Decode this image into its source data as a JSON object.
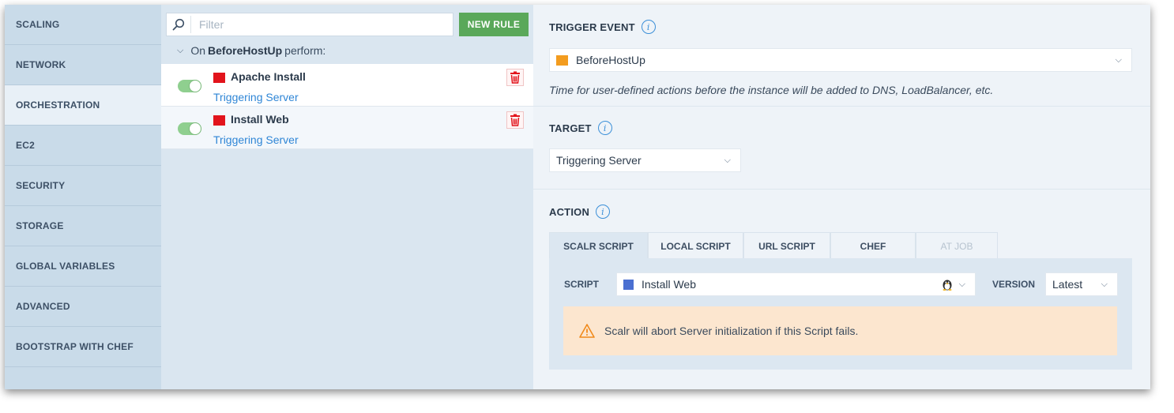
{
  "sidebar": {
    "items": [
      {
        "label": "SCALING"
      },
      {
        "label": "NETWORK"
      },
      {
        "label": "ORCHESTRATION",
        "active": true
      },
      {
        "label": "EC2"
      },
      {
        "label": "SECURITY"
      },
      {
        "label": "STORAGE"
      },
      {
        "label": "GLOBAL VARIABLES"
      },
      {
        "label": "ADVANCED"
      },
      {
        "label": "BOOTSTRAP WITH CHEF"
      }
    ]
  },
  "rules": {
    "filter_placeholder": "Filter",
    "new_rule_label": "NEW RULE",
    "group": {
      "prefix": "On",
      "event": "BeforeHostUp",
      "suffix": "perform:"
    },
    "items": [
      {
        "name": "Apache Install",
        "target": "Triggering Server",
        "color": "#e2141c",
        "enabled": true
      },
      {
        "name": "Install Web",
        "target": "Triggering Server",
        "color": "#e2141c",
        "enabled": true
      }
    ]
  },
  "trigger": {
    "title": "TRIGGER EVENT",
    "value": "BeforeHostUp",
    "value_color": "#f39c1f",
    "hint": "Time for user-defined actions before the instance will be added to DNS, LoadBalancer, etc."
  },
  "target": {
    "title": "TARGET",
    "value": "Triggering Server"
  },
  "action": {
    "title": "ACTION",
    "tabs": [
      {
        "label": "SCALR SCRIPT",
        "state": "active"
      },
      {
        "label": "LOCAL SCRIPT",
        "state": "normal"
      },
      {
        "label": "URL SCRIPT",
        "state": "normal"
      },
      {
        "label": "CHEF",
        "state": "normal"
      },
      {
        "label": "AT JOB",
        "state": "disabled"
      }
    ],
    "script_label": "SCRIPT",
    "script_value": "Install Web",
    "script_color": "#4a6fd1",
    "version_label": "VERSION",
    "version_value": "Latest",
    "warning": "Scalr will abort Server initialization if this Script fails."
  },
  "colors": {
    "accent_green": "#5aa85a",
    "link_blue": "#2f86d6",
    "warning_bg": "#fce6cf"
  }
}
